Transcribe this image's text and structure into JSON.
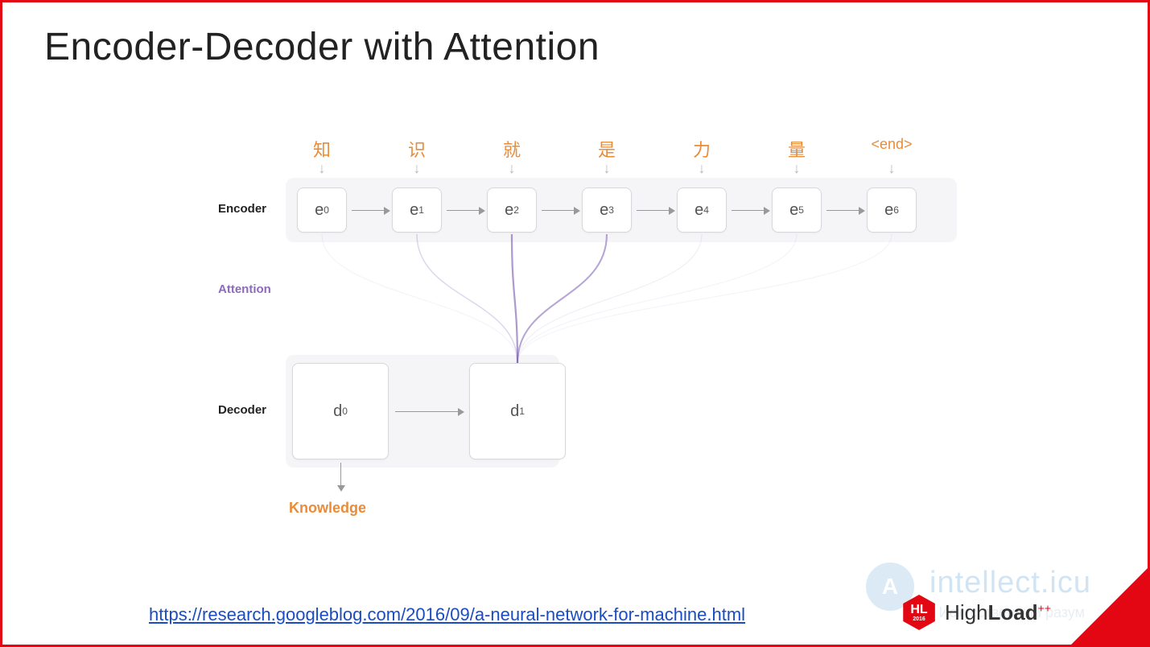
{
  "title": "Encoder-Decoder with Attention",
  "labels": {
    "encoder": "Encoder",
    "attention": "Attention",
    "decoder": "Decoder",
    "knowledge": "Knowledge"
  },
  "input_tokens": [
    "知",
    "识",
    "就",
    "是",
    "力",
    "量",
    "<end>"
  ],
  "encoder_cells": [
    "e0",
    "e1",
    "e2",
    "e3",
    "e4",
    "e5",
    "e6"
  ],
  "decoder_cells": [
    "d0",
    "d1"
  ],
  "attention_weights": {
    "target": "d1",
    "edges": [
      {
        "from": "e0",
        "weight": 0.06
      },
      {
        "from": "e1",
        "weight": 0.25
      },
      {
        "from": "e2",
        "weight": 0.62
      },
      {
        "from": "e3",
        "weight": 0.55
      },
      {
        "from": "e4",
        "weight": 0.1
      },
      {
        "from": "e5",
        "weight": 0.06
      },
      {
        "from": "e6",
        "weight": 0.04
      }
    ]
  },
  "source_url": "https://research.googleblog.com/2016/09/a-neural-network-for-machine.html",
  "watermark": {
    "brand": "intellect.icu",
    "tagline": "Искусственный разум",
    "badge": "A"
  },
  "conference": {
    "badge": "HL",
    "year": "2016",
    "name_light": "High",
    "name_bold": "Load",
    "suffix": "++"
  }
}
